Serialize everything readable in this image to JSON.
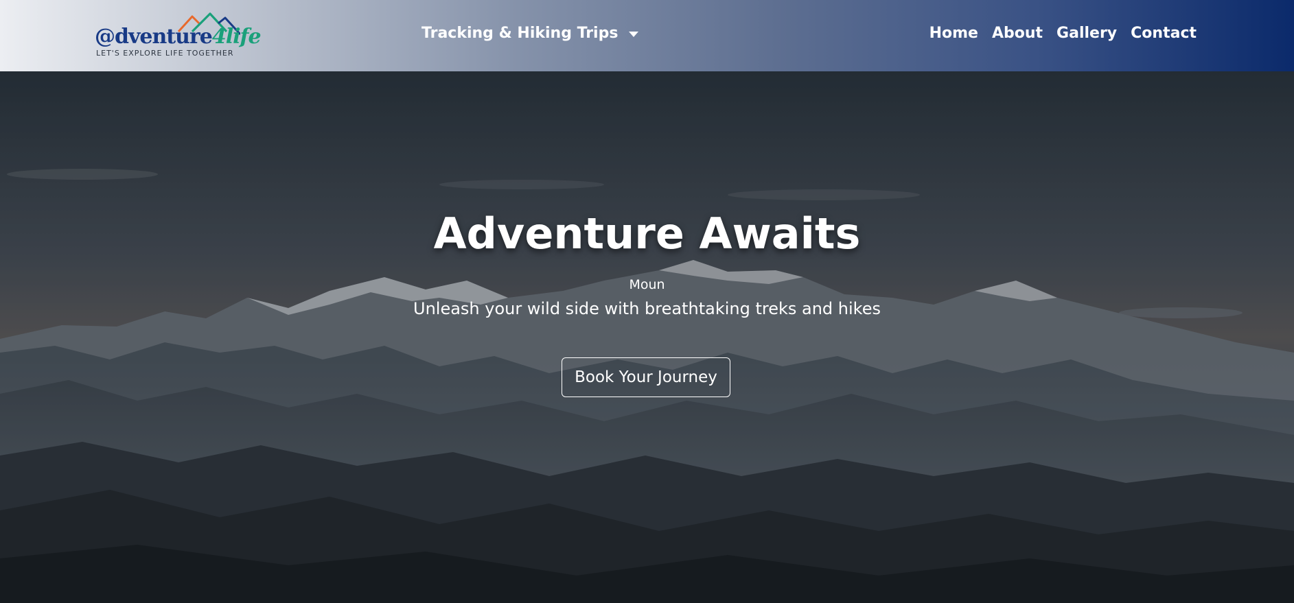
{
  "brand": {
    "logo_prefix": "@dventure",
    "logo_accent": "4life",
    "tagline": "LET'S EXPLORE LIFE TOGETHER"
  },
  "nav": {
    "dropdown_label": "Tracking & Hiking Trips",
    "links": [
      "Home",
      "About",
      "Gallery",
      "Contact"
    ]
  },
  "hero": {
    "title": "Adventure Awaits",
    "small_text": "Moun",
    "subtitle": "Unleash your wild side with breathtaking treks and hikes",
    "cta_label": "Book Your Journey"
  },
  "colors": {
    "nav_gradient_start": "#eceef2",
    "nav_gradient_end": "#0b2a6b",
    "logo_blue": "#183a86",
    "logo_green": "#1aa07a",
    "logo_orange": "#e8692c"
  }
}
